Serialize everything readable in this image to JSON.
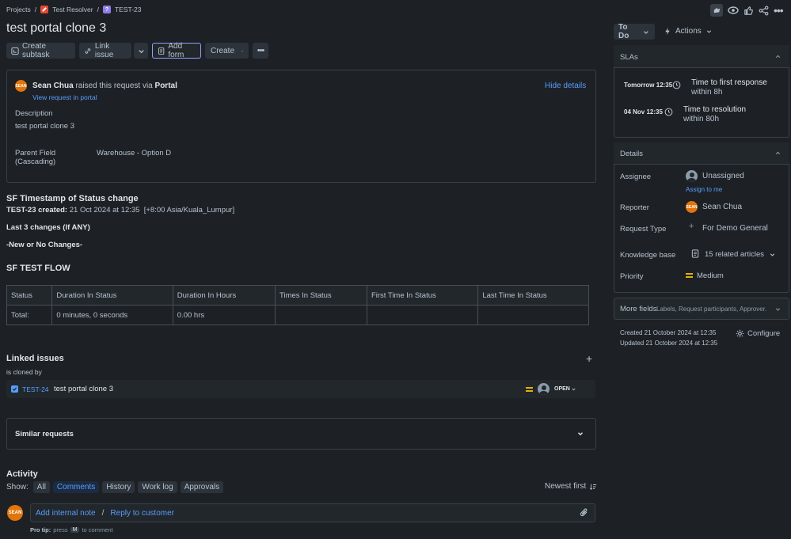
{
  "breadcrumb": {
    "projects": "Projects",
    "project": "Test Resolver",
    "issue": "TEST-23",
    "sep": "/"
  },
  "issue": {
    "title": "test portal clone 3"
  },
  "toolbar": {
    "create_subtask": "Create subtask",
    "link_issue": "Link issue",
    "add_form": "Add form",
    "create": "Create"
  },
  "request": {
    "reporter_name": "Sean Chua",
    "raised_text": "raised this request via",
    "channel": "Portal",
    "view_portal": "View request in portal",
    "hide_details": "Hide details",
    "description_label": "Description",
    "description": "test portal clone 3",
    "parent_field_label": "Parent Field (Cascading)",
    "parent_field_value": "Warehouse - Option D"
  },
  "timestamp_section": {
    "heading": "SF Timestamp of Status change",
    "created_label": "TEST-23 created:",
    "created_value": "21 Oct 2024 at 12:35  [+8:00 Asia/Kuala_Lumpur]",
    "last_changes": "Last 3 changes (If ANY)",
    "no_changes": "-New or No Changes-"
  },
  "flow": {
    "heading": "SF TEST FLOW",
    "columns": [
      "Status",
      "Duration In Status",
      "Duration In Hours",
      "Times In Status",
      "First Time In Status",
      "Last Time In Status"
    ],
    "rows": [
      [
        "Total:",
        "0 minutes, 0 seconds",
        "0.00 hrs",
        "",
        "",
        ""
      ]
    ]
  },
  "linked": {
    "heading": "Linked issues",
    "relation": "is cloned by",
    "key": "TEST-24",
    "summary": "test portal clone 3",
    "status": "OPEN"
  },
  "similar": {
    "heading": "Similar requests"
  },
  "activity": {
    "heading": "Activity",
    "show_label": "Show:",
    "tabs": [
      "All",
      "Comments",
      "History",
      "Work log",
      "Approvals"
    ],
    "sort": "Newest first",
    "add_internal_note": "Add internal note",
    "sep": "/",
    "reply": "Reply to customer",
    "pro_tip_label": "Pro tip:",
    "pro_tip_press": "press",
    "pro_tip_key": "M",
    "pro_tip_rest": "to comment"
  },
  "status_button": "To Do",
  "actions_button": "Actions",
  "slas": {
    "heading": "SLAs",
    "items": [
      {
        "time": "Tomorrow 12:35",
        "title": "Time to first response",
        "sub": "within 8h"
      },
      {
        "time": "04 Nov 12:35",
        "title": "Time to resolution",
        "sub": "within 80h"
      }
    ]
  },
  "details": {
    "heading": "Details",
    "assignee_label": "Assignee",
    "assignee_value": "Unassigned",
    "assign_to_me": "Assign to me",
    "reporter_label": "Reporter",
    "reporter_value": "Sean Chua",
    "request_type_label": "Request Type",
    "request_type_value": "For Demo General",
    "kb_label": "Knowledge base",
    "kb_value": "15 related articles",
    "priority_label": "Priority",
    "priority_value": "Medium"
  },
  "more_fields": {
    "heading": "More fields",
    "sub": "Labels, Request participants, Approver..."
  },
  "meta": {
    "created": "Created 21 October 2024 at 12:35",
    "updated": "Updated 21 October 2024 at 12:35",
    "configure": "Configure"
  },
  "avatar_text": "SEAN",
  "colors": {
    "accent": "#579dff",
    "priority": "#e2b203",
    "avatar": "#e2740c"
  }
}
